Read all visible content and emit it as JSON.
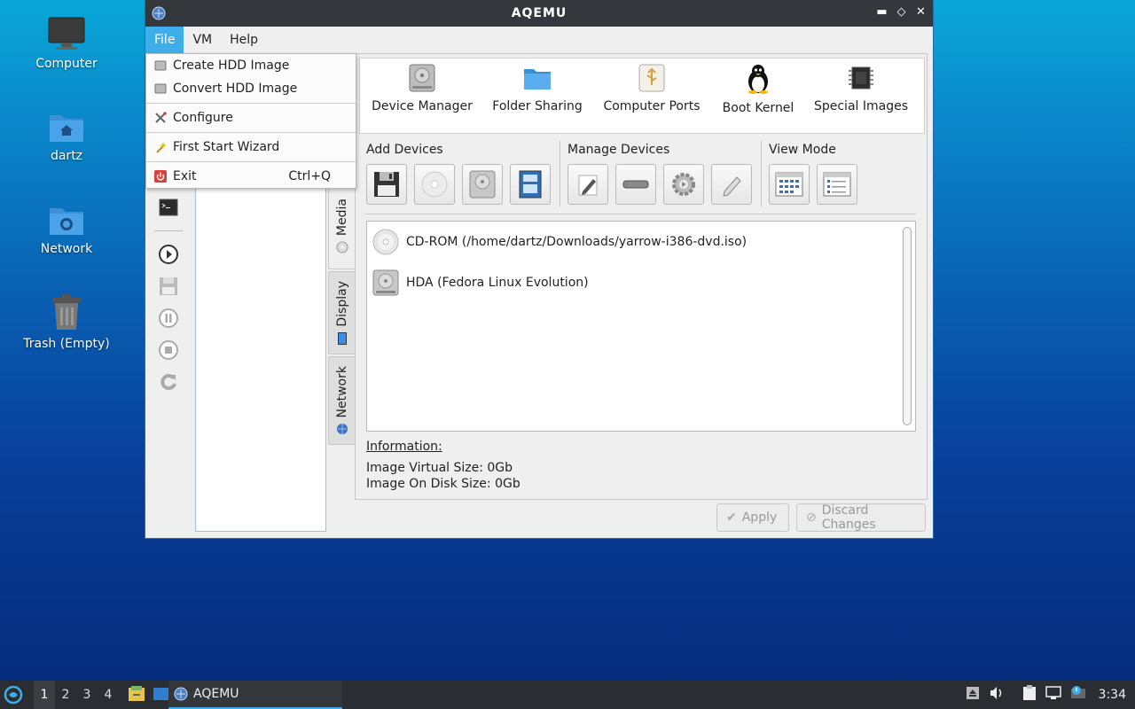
{
  "desktop": {
    "icons": [
      {
        "label": "Computer"
      },
      {
        "label": "dartz"
      },
      {
        "label": "Network"
      },
      {
        "label": "Trash (Empty)"
      }
    ]
  },
  "window": {
    "title": "AQEMU",
    "controls": {
      "minimize": "▬",
      "restore": "◇",
      "close": "✕"
    }
  },
  "menubar": {
    "items": [
      "File",
      "VM",
      "Help"
    ],
    "active": "File"
  },
  "file_menu": {
    "items": [
      {
        "label": "Create HDD Image",
        "icon": "hdd-icon"
      },
      {
        "label": "Convert HDD Image",
        "icon": "hdd-icon"
      },
      {
        "label": "Configure",
        "icon": "tools-icon"
      },
      {
        "label": "First Start Wizard",
        "icon": "wand-icon"
      },
      {
        "label": "Exit",
        "shortcut": "Ctrl+Q",
        "icon": "power-icon"
      }
    ]
  },
  "top_toolbar": {
    "buttons": [
      {
        "label": "Device Manager",
        "icon": "hdd-icon"
      },
      {
        "label": "Folder Sharing",
        "icon": "folder-icon"
      },
      {
        "label": "Computer Ports",
        "icon": "usb-icon"
      },
      {
        "label": "Boot Kernel",
        "icon": "tux-icon"
      },
      {
        "label": "Special Images",
        "icon": "chip-icon"
      }
    ]
  },
  "groups": {
    "add_devices": "Add Devices",
    "manage_devices": "Manage Devices",
    "view_mode": "View Mode"
  },
  "vertical_tabs": [
    {
      "label": "Media",
      "active": true
    },
    {
      "label": "Display",
      "active": false
    },
    {
      "label": "Network",
      "active": false
    }
  ],
  "devices": [
    {
      "label": "CD-ROM (/home/dartz/Downloads/yarrow-i386-dvd.iso)",
      "icon": "cdrom-icon"
    },
    {
      "label": "HDA (Fedora Linux Evolution)",
      "icon": "hdd-icon"
    }
  ],
  "information": {
    "title": "Information:",
    "virtual_size": "Image Virtual Size: 0Gb",
    "disk_size": "Image On Disk Size: 0Gb"
  },
  "actions": {
    "apply": "Apply",
    "discard": "Discard Changes"
  },
  "taskbar": {
    "workspaces": [
      "1",
      "2",
      "3",
      "4"
    ],
    "active_workspace": "1",
    "task_label": "AQEMU",
    "clock": "3:34"
  }
}
